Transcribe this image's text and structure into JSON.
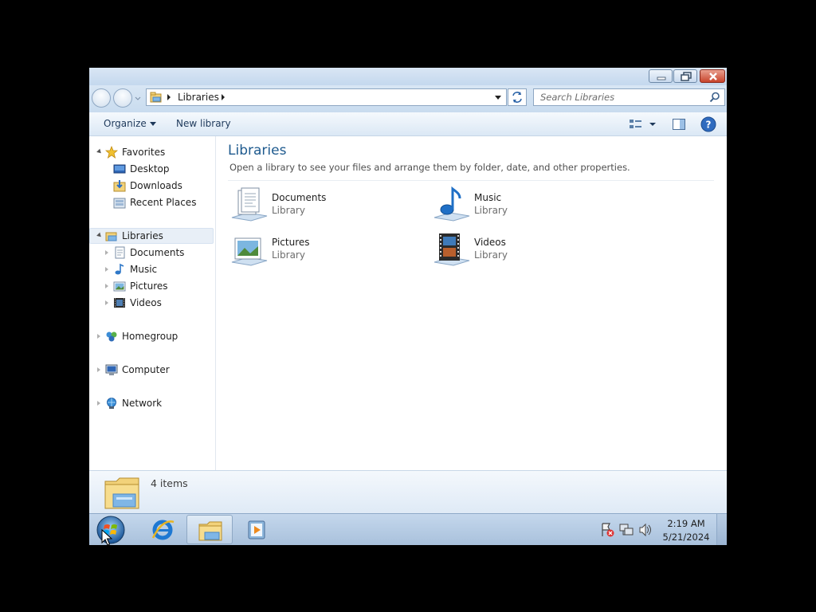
{
  "window": {
    "address_segment": "Libraries",
    "search_placeholder": "Search Libraries"
  },
  "toolbar": {
    "organize_label": "Organize",
    "new_library_label": "New library"
  },
  "nav": {
    "favorites": {
      "label": "Favorites",
      "items": [
        "Desktop",
        "Downloads",
        "Recent Places"
      ]
    },
    "libraries": {
      "label": "Libraries",
      "items": [
        "Documents",
        "Music",
        "Pictures",
        "Videos"
      ]
    },
    "homegroup": "Homegroup",
    "computer": "Computer",
    "network": "Network"
  },
  "content": {
    "title": "Libraries",
    "description": "Open a library to see your files and arrange them by folder, date, and other properties.",
    "items": [
      {
        "name": "Documents",
        "type": "Library",
        "icon": "documents-library-icon"
      },
      {
        "name": "Music",
        "type": "Library",
        "icon": "music-library-icon"
      },
      {
        "name": "Pictures",
        "type": "Library",
        "icon": "pictures-library-icon"
      },
      {
        "name": "Videos",
        "type": "Library",
        "icon": "videos-library-icon"
      }
    ]
  },
  "details": {
    "count": "4 items"
  },
  "taskbar": {
    "time": "2:19 AM",
    "date": "5/21/2024",
    "apps": [
      "internet-explorer-icon",
      "windows-explorer-icon",
      "media-player-icon"
    ]
  },
  "colors": {
    "title_blue": "#1e5a8e",
    "chrome_blue": "#c9dcef",
    "taskbar_blue": "#b4cae3"
  }
}
